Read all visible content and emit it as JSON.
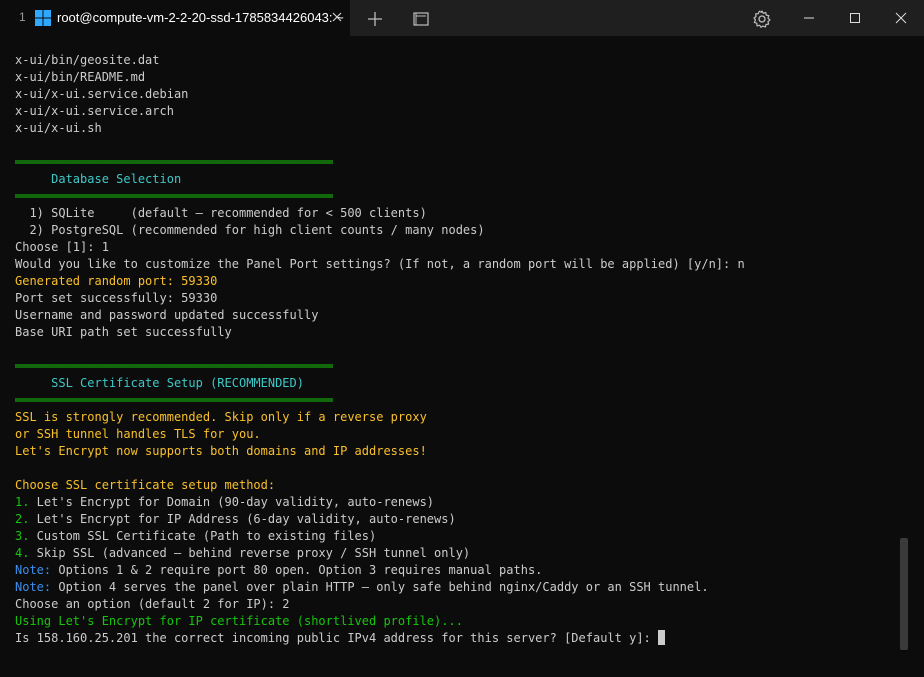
{
  "titlebar": {
    "tab_index": "1",
    "tab_title": "root@compute-vm-2-2-20-ssd-1785834426043: ~",
    "icons": [
      "windows-logo-icon",
      "close-icon",
      "plus-icon",
      "dropdown-icon",
      "gear-icon",
      "minimize-icon",
      "maximize-icon",
      "close-icon"
    ]
  },
  "colors": {
    "background": "#0c0c0c",
    "titlebar": "#1f1f1f",
    "default_text": "#cccccc",
    "green": "#16c60c",
    "yellow": "#f9c02b",
    "blue": "#3b8eea",
    "title_cyan": "#3fc8c8"
  },
  "terminal": {
    "lines": [
      {
        "segments": [
          {
            "text": "x-ui/bin/geosite.dat",
            "color": "default"
          }
        ]
      },
      {
        "segments": [
          {
            "text": "x-ui/bin/README.md",
            "color": "default"
          }
        ]
      },
      {
        "segments": [
          {
            "text": "x-ui/x-ui.service.debian",
            "color": "default"
          }
        ]
      },
      {
        "segments": [
          {
            "text": "x-ui/x-ui.service.arch",
            "color": "default"
          }
        ]
      },
      {
        "segments": [
          {
            "text": "x-ui/x-ui.sh",
            "color": "default"
          }
        ]
      },
      {
        "segments": [
          {
            "text": "",
            "color": "default"
          }
        ]
      },
      {
        "segments": [
          {
            "text": "════════════════════════════════════════════",
            "color": "green"
          }
        ]
      },
      {
        "segments": [
          {
            "text": "     Database Selection",
            "color": "title"
          }
        ]
      },
      {
        "segments": [
          {
            "text": "════════════════════════════════════════════",
            "color": "green"
          }
        ]
      },
      {
        "segments": [
          {
            "text": "  1) SQLite     (default — recommended for < 500 clients)",
            "color": "default"
          }
        ]
      },
      {
        "segments": [
          {
            "text": "  2) PostgreSQL (recommended for high client counts / many nodes)",
            "color": "default"
          }
        ]
      },
      {
        "segments": [
          {
            "text": "Choose [1]: 1",
            "color": "default"
          }
        ]
      },
      {
        "segments": [
          {
            "text": "Would you like to customize the Panel Port settings? (If not, a random port will be applied) [y/n]: n",
            "color": "default"
          }
        ]
      },
      {
        "segments": [
          {
            "text": "Generated random port: 59330",
            "color": "yellow"
          }
        ]
      },
      {
        "segments": [
          {
            "text": "Port set successfully: 59330",
            "color": "default"
          }
        ]
      },
      {
        "segments": [
          {
            "text": "Username and password updated successfully",
            "color": "default"
          }
        ]
      },
      {
        "segments": [
          {
            "text": "Base URI path set successfully",
            "color": "default"
          }
        ]
      },
      {
        "segments": [
          {
            "text": "",
            "color": "default"
          }
        ]
      },
      {
        "segments": [
          {
            "text": "════════════════════════════════════════════",
            "color": "green"
          }
        ]
      },
      {
        "segments": [
          {
            "text": "     SSL Certificate Setup (RECOMMENDED)",
            "color": "title"
          }
        ]
      },
      {
        "segments": [
          {
            "text": "════════════════════════════════════════════",
            "color": "green"
          }
        ]
      },
      {
        "segments": [
          {
            "text": "SSL is strongly recommended. Skip only if a reverse proxy",
            "color": "yellow"
          }
        ]
      },
      {
        "segments": [
          {
            "text": "or SSH tunnel handles TLS for you.",
            "color": "yellow"
          }
        ]
      },
      {
        "segments": [
          {
            "text": "Let's Encrypt now supports both domains and IP addresses!",
            "color": "yellow"
          }
        ]
      },
      {
        "segments": [
          {
            "text": "",
            "color": "default"
          }
        ]
      },
      {
        "segments": [
          {
            "text": "Choose SSL certificate setup method:",
            "color": "yellow"
          }
        ]
      },
      {
        "segments": [
          {
            "text": "1.",
            "color": "green"
          },
          {
            "text": " Let's Encrypt for Domain (90-day validity, auto-renews)",
            "color": "default"
          }
        ]
      },
      {
        "segments": [
          {
            "text": "2.",
            "color": "green"
          },
          {
            "text": " Let's Encrypt for IP Address (6-day validity, auto-renews)",
            "color": "default"
          }
        ]
      },
      {
        "segments": [
          {
            "text": "3.",
            "color": "green"
          },
          {
            "text": " Custom SSL Certificate (Path to existing files)",
            "color": "default"
          }
        ]
      },
      {
        "segments": [
          {
            "text": "4.",
            "color": "green"
          },
          {
            "text": " Skip SSL (advanced — behind reverse proxy / SSH tunnel only)",
            "color": "default"
          }
        ]
      },
      {
        "segments": [
          {
            "text": "Note:",
            "color": "blue"
          },
          {
            "text": " Options 1 & 2 require port 80 open. Option 3 requires manual paths.",
            "color": "default"
          }
        ]
      },
      {
        "segments": [
          {
            "text": "Note:",
            "color": "blue"
          },
          {
            "text": " Option 4 serves the panel over plain HTTP — only safe behind nginx/Caddy or an SSH tunnel.",
            "color": "default"
          }
        ]
      },
      {
        "segments": [
          {
            "text": "Choose an option (default 2 for IP): 2",
            "color": "default"
          }
        ]
      },
      {
        "segments": [
          {
            "text": "Using Let's Encrypt for IP certificate (shortlived profile)...",
            "color": "green"
          }
        ]
      },
      {
        "segments": [
          {
            "text": "Is 158.160.25.201 the correct incoming public IPv4 address for this server? [Default y]: ",
            "color": "default"
          }
        ],
        "cursor": true
      }
    ]
  }
}
